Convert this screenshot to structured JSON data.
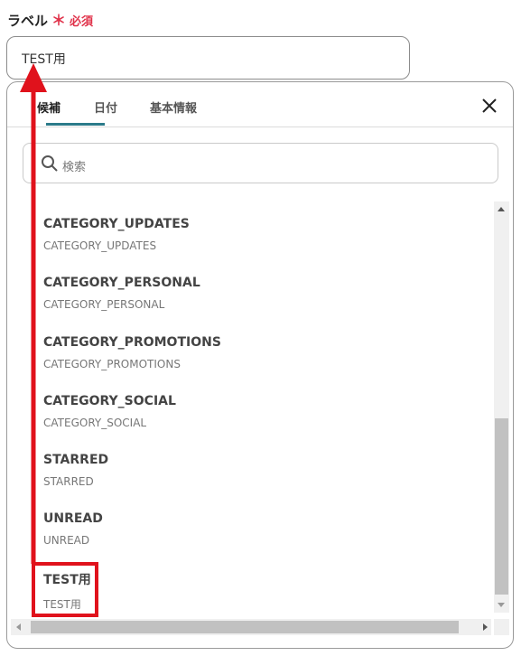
{
  "field": {
    "label": "ラベル",
    "required_mark": "＊",
    "required_text": "必須",
    "value": "TEST用"
  },
  "tabs": [
    {
      "label": "候補",
      "active": true
    },
    {
      "label": "日付",
      "active": false
    },
    {
      "label": "基本情報",
      "active": false
    }
  ],
  "search": {
    "placeholder": "検索"
  },
  "items": [
    {
      "title": "CATEGORY_UPDATES",
      "subtitle": "CATEGORY_UPDATES"
    },
    {
      "title": "CATEGORY_PERSONAL",
      "subtitle": "CATEGORY_PERSONAL"
    },
    {
      "title": "CATEGORY_PROMOTIONS",
      "subtitle": "CATEGORY_PROMOTIONS"
    },
    {
      "title": "CATEGORY_SOCIAL",
      "subtitle": "CATEGORY_SOCIAL"
    },
    {
      "title": "STARRED",
      "subtitle": "STARRED"
    },
    {
      "title": "UNREAD",
      "subtitle": "UNREAD"
    },
    {
      "title": "TEST用",
      "subtitle": "TEST用"
    }
  ],
  "icons": {
    "close": "close-icon",
    "search": "search-icon"
  },
  "colors": {
    "required": "#e0324a",
    "annotation": "#e0121c",
    "active_tab": "#2c7b8a"
  }
}
